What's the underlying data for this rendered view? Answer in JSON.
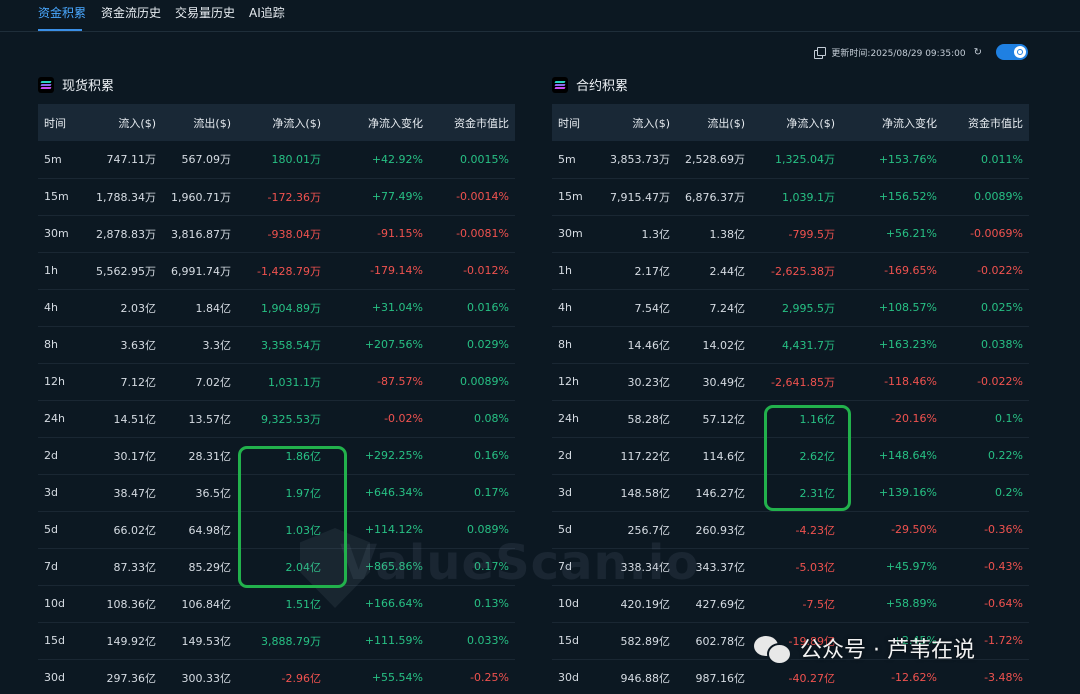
{
  "tabs": [
    "资金积累",
    "资金流历史",
    "交易量历史",
    "AI追踪"
  ],
  "topbar": {
    "update_label": "更新时间:2025/08/29 09:35:00"
  },
  "headers": [
    "时间",
    "流入($)",
    "流出($)",
    "净流入($)",
    "净流入变化",
    "资金市值比"
  ],
  "spot": {
    "title": "现货积累",
    "rows": [
      [
        "5m",
        "747.11万",
        "567.09万",
        "180.01万",
        "+42.92%",
        "0.0015%"
      ],
      [
        "15m",
        "1,788.34万",
        "1,960.71万",
        "-172.36万",
        "+77.49%",
        "-0.0014%"
      ],
      [
        "30m",
        "2,878.83万",
        "3,816.87万",
        "-938.04万",
        "-91.15%",
        "-0.0081%"
      ],
      [
        "1h",
        "5,562.95万",
        "6,991.74万",
        "-1,428.79万",
        "-179.14%",
        "-0.012%"
      ],
      [
        "4h",
        "2.03亿",
        "1.84亿",
        "1,904.89万",
        "+31.04%",
        "0.016%"
      ],
      [
        "8h",
        "3.63亿",
        "3.3亿",
        "3,358.54万",
        "+207.56%",
        "0.029%"
      ],
      [
        "12h",
        "7.12亿",
        "7.02亿",
        "1,031.1万",
        "-87.57%",
        "0.0089%"
      ],
      [
        "24h",
        "14.51亿",
        "13.57亿",
        "9,325.53万",
        "-0.02%",
        "0.08%"
      ],
      [
        "2d",
        "30.17亿",
        "28.31亿",
        "1.86亿",
        "+292.25%",
        "0.16%"
      ],
      [
        "3d",
        "38.47亿",
        "36.5亿",
        "1.97亿",
        "+646.34%",
        "0.17%"
      ],
      [
        "5d",
        "66.02亿",
        "64.98亿",
        "1.03亿",
        "+114.12%",
        "0.089%"
      ],
      [
        "7d",
        "87.33亿",
        "85.29亿",
        "2.04亿",
        "+865.86%",
        "0.17%"
      ],
      [
        "10d",
        "108.36亿",
        "106.84亿",
        "1.51亿",
        "+166.64%",
        "0.13%"
      ],
      [
        "15d",
        "149.92亿",
        "149.53亿",
        "3,888.79万",
        "+111.59%",
        "0.033%"
      ],
      [
        "30d",
        "297.36亿",
        "300.33亿",
        "-2.96亿",
        "+55.54%",
        "-0.25%"
      ]
    ]
  },
  "futures": {
    "title": "合约积累",
    "rows": [
      [
        "5m",
        "3,853.73万",
        "2,528.69万",
        "1,325.04万",
        "+153.76%",
        "0.011%"
      ],
      [
        "15m",
        "7,915.47万",
        "6,876.37万",
        "1,039.1万",
        "+156.52%",
        "0.0089%"
      ],
      [
        "30m",
        "1.3亿",
        "1.38亿",
        "-799.5万",
        "+56.21%",
        "-0.0069%"
      ],
      [
        "1h",
        "2.17亿",
        "2.44亿",
        "-2,625.38万",
        "-169.65%",
        "-0.022%"
      ],
      [
        "4h",
        "7.54亿",
        "7.24亿",
        "2,995.5万",
        "+108.57%",
        "0.025%"
      ],
      [
        "8h",
        "14.46亿",
        "14.02亿",
        "4,431.7万",
        "+163.23%",
        "0.038%"
      ],
      [
        "12h",
        "30.23亿",
        "30.49亿",
        "-2,641.85万",
        "-118.46%",
        "-0.022%"
      ],
      [
        "24h",
        "58.28亿",
        "57.12亿",
        "1.16亿",
        "-20.16%",
        "0.1%"
      ],
      [
        "2d",
        "117.22亿",
        "114.6亿",
        "2.62亿",
        "+148.64%",
        "0.22%"
      ],
      [
        "3d",
        "148.58亿",
        "146.27亿",
        "2.31亿",
        "+139.16%",
        "0.2%"
      ],
      [
        "5d",
        "256.7亿",
        "260.93亿",
        "-4.23亿",
        "-29.50%",
        "-0.36%"
      ],
      [
        "7d",
        "338.34亿",
        "343.37亿",
        "-5.03亿",
        "+45.97%",
        "-0.43%"
      ],
      [
        "10d",
        "420.19亿",
        "427.69亿",
        "-7.5亿",
        "+58.89%",
        "-0.64%"
      ],
      [
        "15d",
        "582.89亿",
        "602.78亿",
        "-19.89亿",
        "+2.45%",
        "-1.72%"
      ],
      [
        "30d",
        "946.88亿",
        "987.16亿",
        "-40.27亿",
        "-12.62%",
        "-3.48%"
      ]
    ]
  },
  "watermark": "ValueScan.io",
  "wechat_caption": "公众号 · 芦苇在说",
  "colors": {
    "positive": "#27c084",
    "negative": "#f0524f",
    "accent": "#3b8fe6",
    "highlight": "#22b14c"
  }
}
